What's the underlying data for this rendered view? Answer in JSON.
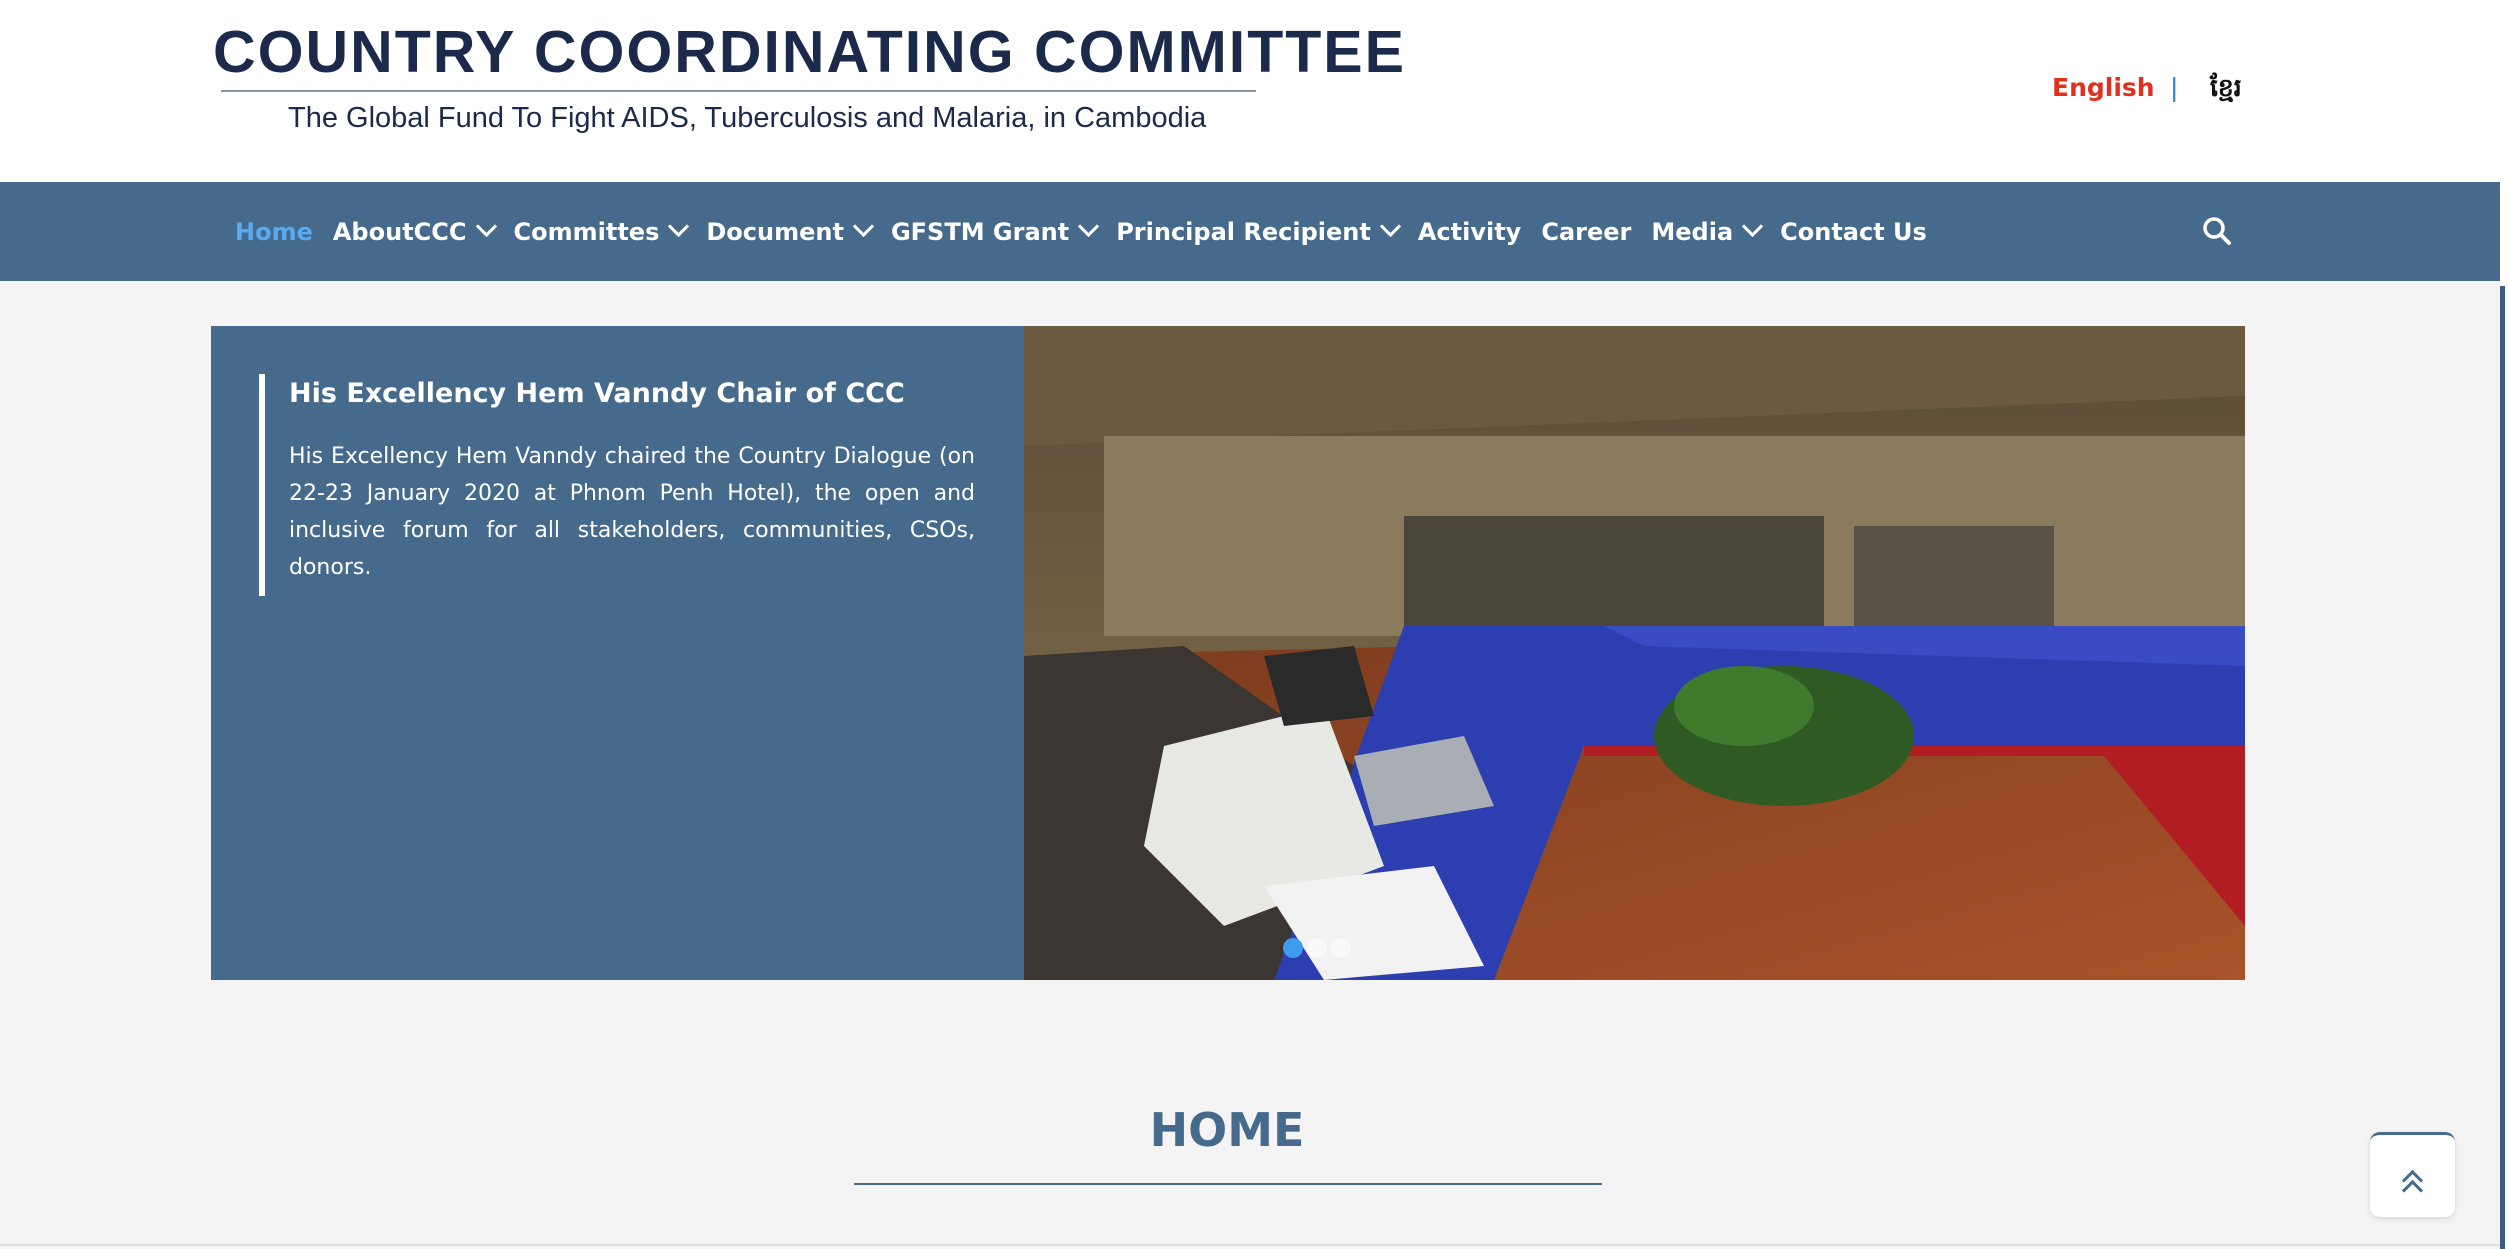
{
  "header": {
    "title": "COUNTRY COORDINATING COMMITTEE",
    "subtitle": "The Global Fund To Fight AIDS, Tuberculosis and Malaria, in Cambodia"
  },
  "language": {
    "english": "English",
    "separator": "|",
    "khmer": "ខ្មែរ"
  },
  "nav": {
    "items": [
      {
        "label": "Home",
        "dropdown": false,
        "active": true
      },
      {
        "label": "AboutCCC",
        "dropdown": true
      },
      {
        "label": "Committes",
        "dropdown": true
      },
      {
        "label": "Document",
        "dropdown": true
      },
      {
        "label": "GFSTM Grant",
        "dropdown": true
      },
      {
        "label": "Principal Recipient",
        "dropdown": true
      },
      {
        "label": "Activity",
        "dropdown": false
      },
      {
        "label": "Career",
        "dropdown": false
      },
      {
        "label": "Media",
        "dropdown": true
      },
      {
        "label": "Contact Us",
        "dropdown": false
      }
    ],
    "search_icon": "search-icon"
  },
  "slider": {
    "title": "His Excellency Hem Vanndy Chair of CCC",
    "text": "His Excellency Hem Vanndy chaired the Country Dialogue (on 22-23 January 2020 at Phnom Penh Hotel), the open and inclusive forum for all stakeholders, communities, CSOs, donors.",
    "active_dot": 1
  },
  "section": {
    "title": "HOME"
  },
  "colors": {
    "nav_bg": "#466a8c",
    "active_nav": "#5aaaf0",
    "english_link": "#e0301e",
    "title_text": "#1b2a4a"
  },
  "icons": {
    "back_to_top": "double-chevron-up-icon"
  }
}
